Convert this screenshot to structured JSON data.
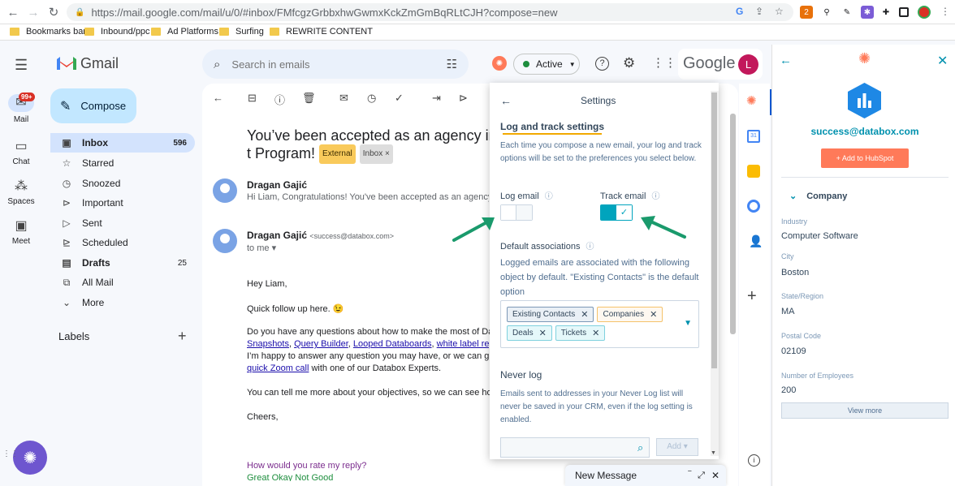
{
  "browser": {
    "url": "https://mail.google.com/mail/u/0/#inbox/FMfcgzGrbbxhwGwmxKckZmGmBqRLtCJH?compose=new",
    "bookmarks": [
      "Bookmarks bar",
      "Inbound/ppc",
      "Ad Platforms",
      "Surfing",
      "REWRITE CONTENT"
    ],
    "ext_badge": "2"
  },
  "gmail": {
    "logo": "Gmail",
    "rail": [
      {
        "label": "Mail",
        "badge": "99+"
      },
      {
        "label": "Chat"
      },
      {
        "label": "Spaces"
      },
      {
        "label": "Meet"
      }
    ],
    "compose": "Compose",
    "nav": [
      {
        "label": "Inbox",
        "count": "596"
      },
      {
        "label": "Starred",
        "count": ""
      },
      {
        "label": "Snoozed",
        "count": ""
      },
      {
        "label": "Important",
        "count": ""
      },
      {
        "label": "Sent",
        "count": ""
      },
      {
        "label": "Scheduled",
        "count": ""
      },
      {
        "label": "Drafts",
        "count": "25"
      },
      {
        "label": "All Mail",
        "count": ""
      },
      {
        "label": "More",
        "count": ""
      }
    ],
    "labels_heading": "Labels",
    "search_placeholder": "Search in emails",
    "status": "Active",
    "google_logo": "Google",
    "account_initial": "L"
  },
  "email": {
    "subject": "You’ve been accepted as an agency in t Program!",
    "tag_external": "External",
    "tag_inbox": "Inbox ×",
    "msg1_sender": "Dragan Gajić",
    "msg1_snippet": "Hi Liam, Congratulations! You've been accepted as an agency in the",
    "msg2_sender": "Dragan Gajić",
    "msg2_email": "<success@databox.com>",
    "msg2_to": "to me ▾",
    "greeting": "Hey Liam,",
    "line1": "Quick follow up here. 😉",
    "line2": "Do you have any questions about how to make the most of Databox",
    "link1": "Snapshots",
    "link2": "Query Builder",
    "link3": "Looped Databoards",
    "link4": "white label reporting",
    "line4": "I’m happy to answer any question you may have, or we can give you",
    "link5": "quick Zoom call",
    "line5_rest": " with one of our Databox Experts.",
    "line6": "You can tell me more about your objectives, so we can see how Dat",
    "cheers": "Cheers,",
    "rate": "How would you rate my reply?",
    "rate_opts": "Great    Okay    Not Good"
  },
  "settings": {
    "title": "Settings",
    "section_title": "Log and track settings",
    "intro": "Each time you compose a new email, your log and track options will be set to the preferences you select below.",
    "log_email": "Log email",
    "track_email": "Track email",
    "log_on": false,
    "track_on": true,
    "default_assoc": "Default associations",
    "assoc_desc": "Logged emails are associated with the following object by default. \"Existing Contacts\" is the default option",
    "chips": [
      {
        "label": "Existing Contacts",
        "color": "#7c98b6",
        "bg": "#eaf0f6"
      },
      {
        "label": "Companies",
        "color": "#f5c26b",
        "bg": "#fef8f0"
      },
      {
        "label": "Deals",
        "color": "#7fd1de",
        "bg": "#e5f8fa"
      },
      {
        "label": "Tickets",
        "color": "#7fd1de",
        "bg": "#e5f8fa"
      }
    ],
    "never_log": "Never log",
    "never_desc": "Emails sent to addresses in your Never Log list will never be saved in your CRM, even if the log setting is enabled.",
    "add_btn": "Add ▾"
  },
  "hubspot": {
    "email": "success@databox.com",
    "add_btn": "+ Add to HubSpot",
    "company_heading": "Company",
    "fields": [
      {
        "label": "Industry",
        "value": "Computer Software"
      },
      {
        "label": "City",
        "value": "Boston"
      },
      {
        "label": "State/Region",
        "value": "MA"
      },
      {
        "label": "Postal Code",
        "value": "02109"
      },
      {
        "label": "Number of Employees",
        "value": "200"
      }
    ],
    "view_more": "View more"
  },
  "new_message": "New Message",
  "colors": {
    "hubspot_orange": "#ff7a59",
    "teal": "#00a4bd",
    "arrow_green": "#1a9a6c",
    "underline": "#f2a900"
  }
}
